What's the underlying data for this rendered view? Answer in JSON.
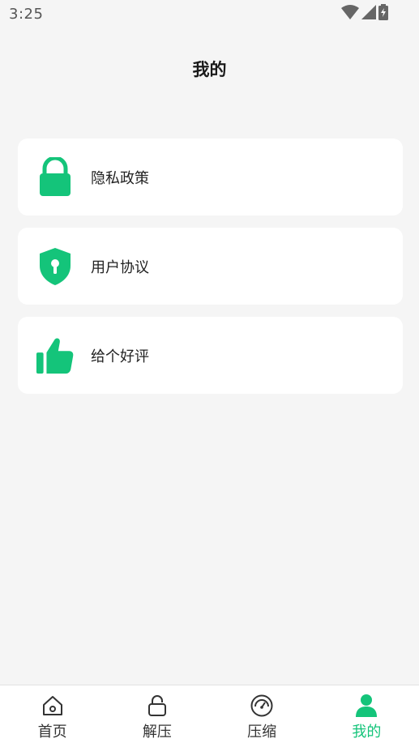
{
  "status_bar": {
    "time": "3:25"
  },
  "header": {
    "title": "我的"
  },
  "menu": [
    {
      "label": "隐私政策",
      "icon": "lock-icon"
    },
    {
      "label": "用户协议",
      "icon": "shield-keyhole-icon"
    },
    {
      "label": "给个好评",
      "icon": "thumbs-up-icon"
    }
  ],
  "tabbar": {
    "active_index": 3,
    "tabs": [
      {
        "label": "首页",
        "icon": "home-icon"
      },
      {
        "label": "解压",
        "icon": "unlock-icon"
      },
      {
        "label": "压缩",
        "icon": "gauge-icon"
      },
      {
        "label": "我的",
        "icon": "user-icon"
      }
    ]
  },
  "colors": {
    "accent": "#14c47a",
    "background": "#f5f5f5",
    "card": "#ffffff"
  }
}
